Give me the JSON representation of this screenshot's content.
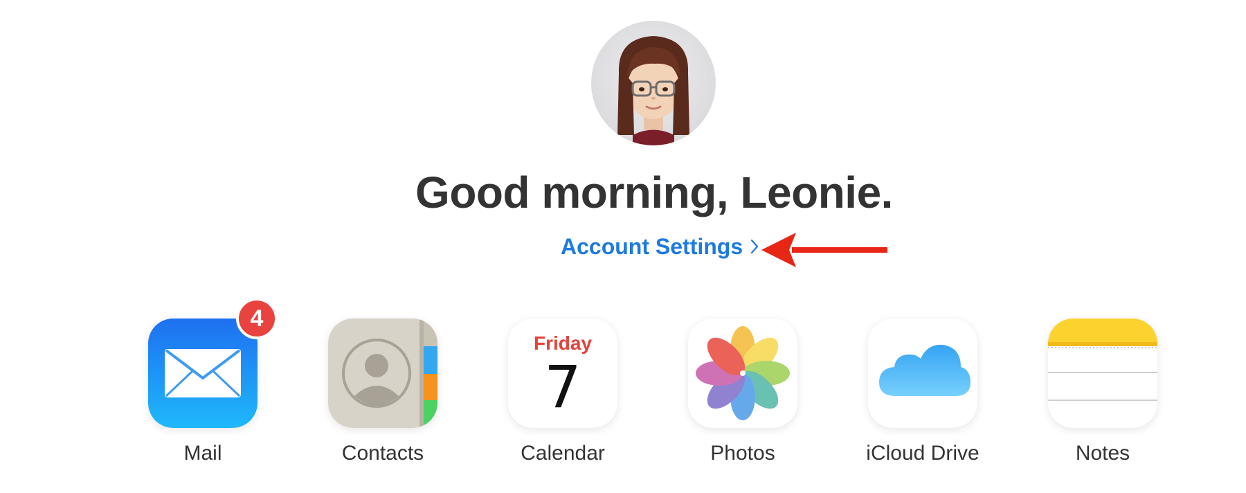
{
  "header": {
    "greeting": "Good morning, Leonie.",
    "account_settings_label": "Account Settings",
    "link_color": "#1d7ae0"
  },
  "annotation": {
    "arrow_color": "#e82616",
    "icon": "arrow-left-icon"
  },
  "apps": [
    {
      "label": "Mail",
      "icon": "mail-icon",
      "badge": "4"
    },
    {
      "label": "Contacts",
      "icon": "contacts-icon"
    },
    {
      "label": "Calendar",
      "icon": "calendar-icon",
      "day": "Friday",
      "date": "7"
    },
    {
      "label": "Photos",
      "icon": "photos-icon"
    },
    {
      "label": "iCloud Drive",
      "icon": "icloud-drive-icon"
    },
    {
      "label": "Notes",
      "icon": "notes-icon"
    }
  ]
}
